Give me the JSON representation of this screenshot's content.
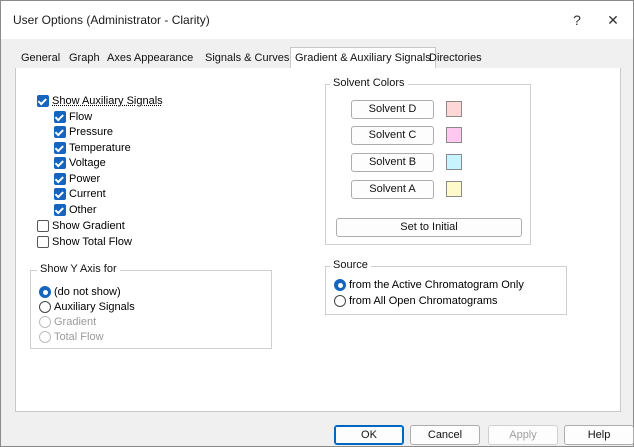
{
  "window": {
    "title": "User Options (Administrator - Clarity)",
    "help_glyph": "?",
    "close_glyph": "✕"
  },
  "tabs": [
    {
      "label": "General"
    },
    {
      "label": "Graph"
    },
    {
      "label": "Axes Appearance"
    },
    {
      "label": "Signals & Curves"
    },
    {
      "label": "Gradient & Auxiliary Signals",
      "active": true
    },
    {
      "label": "Directories"
    }
  ],
  "aux": {
    "show_aux_label": "Show Auxiliary Signals",
    "items": [
      {
        "label": "Flow",
        "checked": true
      },
      {
        "label": "Pressure",
        "checked": true
      },
      {
        "label": "Temperature",
        "checked": true
      },
      {
        "label": "Voltage",
        "checked": true
      },
      {
        "label": "Power",
        "checked": true
      },
      {
        "label": "Current",
        "checked": true
      },
      {
        "label": "Other",
        "checked": true
      }
    ],
    "show_gradient_label": "Show Gradient",
    "show_total_flow_label": "Show Total Flow"
  },
  "y_axis": {
    "title": "Show Y Axis for",
    "options": [
      {
        "label": "(do not show)",
        "selected": true,
        "enabled": true
      },
      {
        "label": "Auxiliary Signals",
        "selected": false,
        "enabled": true
      },
      {
        "label": "Gradient",
        "selected": false,
        "enabled": false
      },
      {
        "label": "Total Flow",
        "selected": false,
        "enabled": false
      }
    ]
  },
  "solvent": {
    "title": "Solvent Colors",
    "items": [
      {
        "label": "Solvent D",
        "color": "#ffd6d6"
      },
      {
        "label": "Solvent C",
        "color": "#ffc8f0"
      },
      {
        "label": "Solvent B",
        "color": "#c8f4ff"
      },
      {
        "label": "Solvent A",
        "color": "#fffacc"
      }
    ],
    "reset_label": "Set to Initial"
  },
  "source": {
    "title": "Source",
    "options": [
      {
        "label": "from the Active Chromatogram Only",
        "selected": true
      },
      {
        "label": "from All Open Chromatograms",
        "selected": false
      }
    ]
  },
  "footer": {
    "ok": "OK",
    "cancel": "Cancel",
    "apply": "Apply",
    "help": "Help"
  },
  "colors": {
    "accent": "#1565c0",
    "panel": "#ffffff",
    "chrome": "#f0f0f0"
  }
}
